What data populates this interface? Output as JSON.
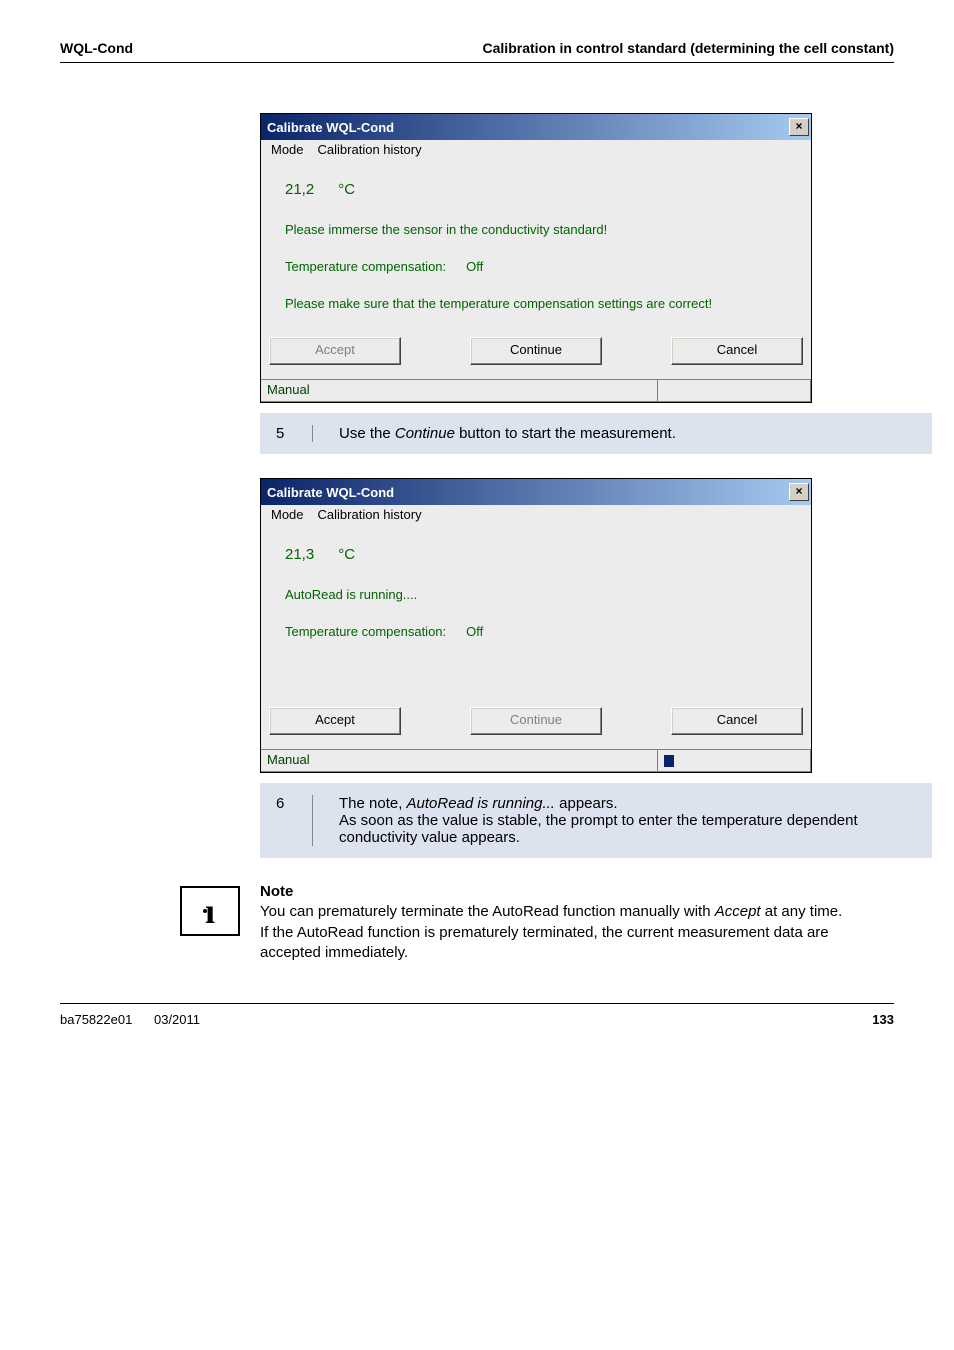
{
  "header": {
    "left": "WQL-Cond",
    "right": "Calibration in control standard (determining the cell constant)"
  },
  "dialog1": {
    "title": "Calibrate WQL-Cond",
    "close_glyph": "×",
    "menu": {
      "mode": "Mode",
      "history": "Calibration history"
    },
    "temp_value": "21,2",
    "temp_unit": "°C",
    "info_line": "Please immerse the sensor in the conductivity standard!",
    "tc_label": "Temperature compensation:",
    "tc_value": "Off",
    "warn_line": "Please make sure that the temperature compensation settings are correct!",
    "buttons": {
      "accept": "Accept",
      "continue": "Continue",
      "cancel": "Cancel"
    },
    "status": "Manual"
  },
  "step5": {
    "num": "5",
    "text_pre": "Use the ",
    "text_em": "Continue",
    "text_post": " button to start the measurement."
  },
  "dialog2": {
    "title": "Calibrate WQL-Cond",
    "close_glyph": "×",
    "menu": {
      "mode": "Mode",
      "history": "Calibration history"
    },
    "temp_value": "21,3",
    "temp_unit": "°C",
    "info_line": "AutoRead is running....",
    "tc_label": "Temperature compensation:",
    "tc_value": "Off",
    "buttons": {
      "accept": "Accept",
      "continue": "Continue",
      "cancel": "Cancel"
    },
    "status": "Manual"
  },
  "step6": {
    "num": "6",
    "line1_pre": "The note, ",
    "line1_em": "AutoRead is running...",
    "line1_post": " appears.",
    "line2": "As soon as the value is stable, the prompt to enter the temperature dependent conductivity value appears."
  },
  "note": {
    "heading": "Note",
    "body_pre": "You can prematurely terminate the AutoRead function manually with ",
    "body_em": "Accept",
    "body_post": " at any time. If the AutoRead function is prematurely terminated, the current measurement data are accepted immediately."
  },
  "footer": {
    "doc": "ba75822e01",
    "date": "03/2011",
    "page": "133"
  }
}
